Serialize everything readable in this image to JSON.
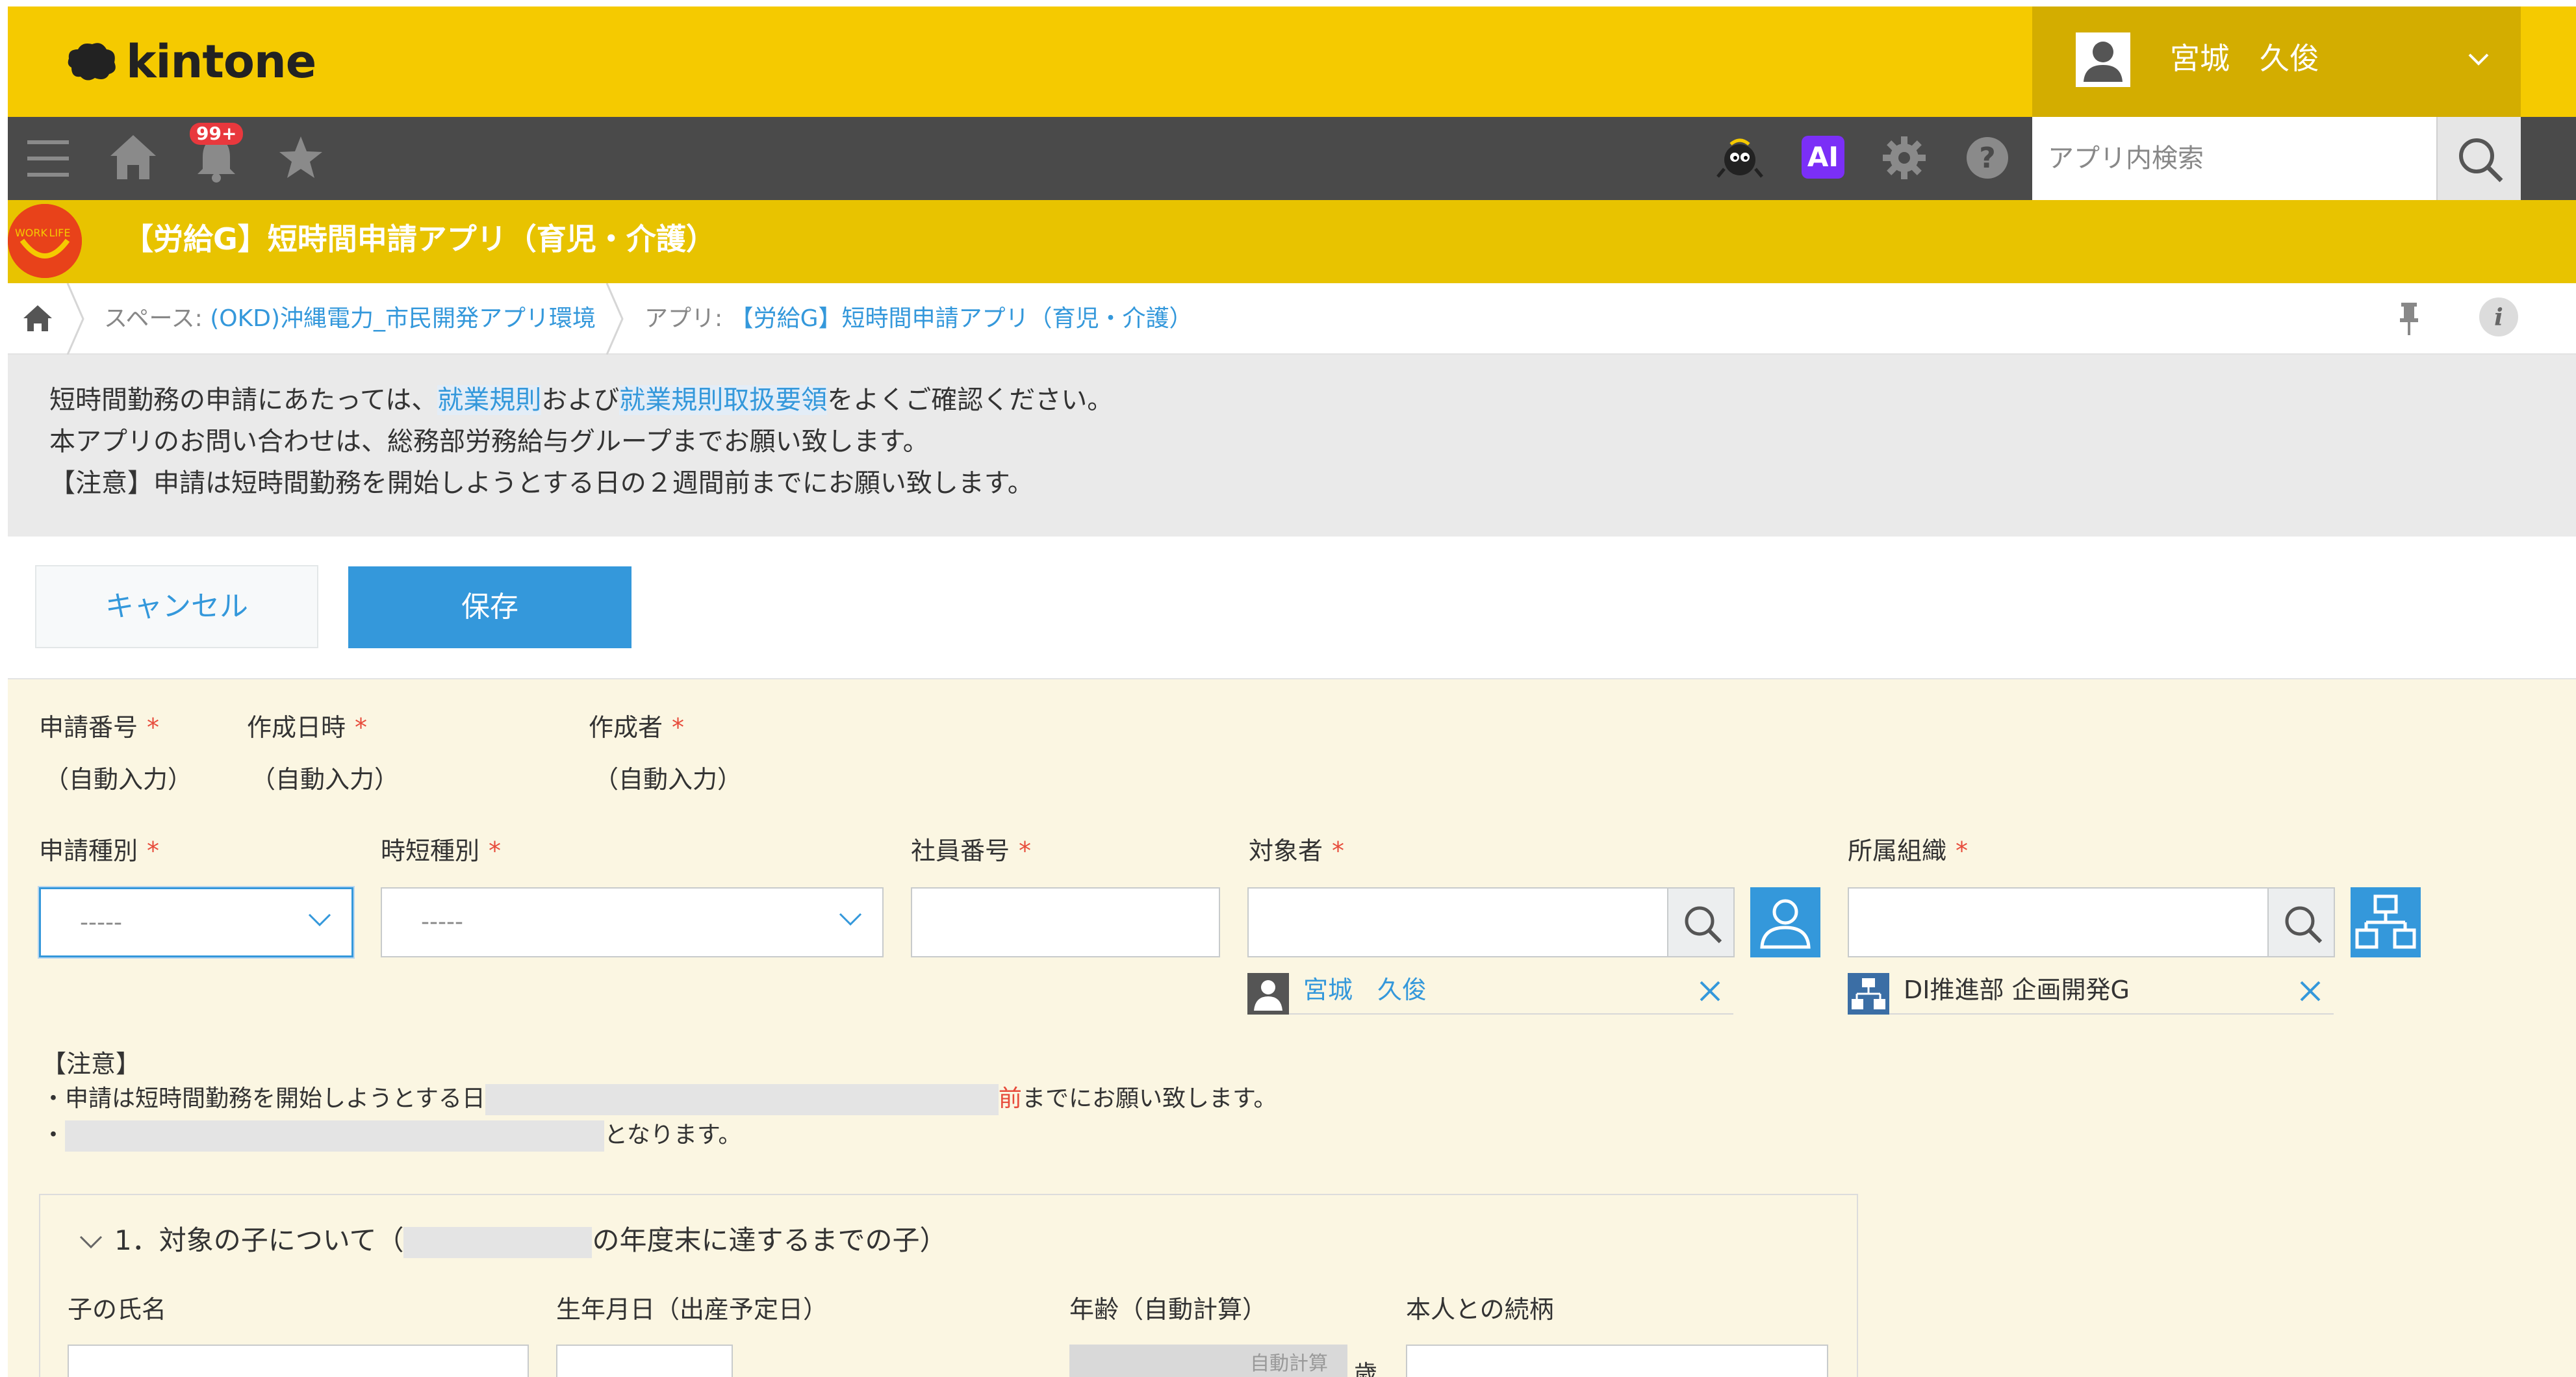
{
  "header": {
    "logo_text": "kintone",
    "user_name": "宮城　久俊",
    "notification_count": "99+",
    "ai_label": "AI",
    "search_placeholder": "アプリ内検索"
  },
  "app": {
    "title": "【労給G】短時間申請アプリ（育児・介護）",
    "icon_text": "WORK LIFE"
  },
  "breadcrumb": {
    "space_prefix": "スペース: ",
    "space_name": "(OKD)沖縄電力_市民開発アプリ環境",
    "app_prefix": "アプリ: ",
    "app_name": "【労給G】短時間申請アプリ（育児・介護）"
  },
  "notice": {
    "line1_a": "短時間勤務の申請にあたっては、",
    "line1_link1": "就業規則",
    "line1_b": "および",
    "line1_link2": "就業規則取扱要領",
    "line1_c": "をよくご確認ください。",
    "line2": "本アプリのお問い合わせは、総務部労務給与グループまでお願い致します。",
    "line3": "【注意】申請は短時間勤務を開始しようとする日の２週間前までにお願い致します。"
  },
  "actions": {
    "cancel_label": "キャンセル",
    "save_label": "保存"
  },
  "form": {
    "row1": {
      "app_no_label": "申請番号",
      "app_no_value": "（自動入力）",
      "created_at_label": "作成日時",
      "created_at_value": "（自動入力）",
      "creator_label": "作成者",
      "creator_value": "（自動入力）"
    },
    "row2": {
      "app_type_label": "申請種別",
      "app_type_value": "-----",
      "short_type_label": "時短種別",
      "short_type_value": "-----",
      "emp_no_label": "社員番号",
      "target_label": "対象者",
      "target_selected": "宮城　久俊",
      "org_label": "所属組織",
      "org_selected": "DI推進部 企画開発G"
    },
    "caution": {
      "title": "【注意】",
      "line1_a": "・申請は短時間勤務を開始しようとする日",
      "line1_mark": "前",
      "line1_b": "までにお願い致します。",
      "line2_a": "・",
      "line2_b": "となります。"
    },
    "section1": {
      "title_a": "1．対象の子について（",
      "title_b": "の年度末に達するまでの子）",
      "child_name_label": "子の氏名",
      "birth_label": "生年月日（出産予定日）",
      "age_label": "年齢（自動計算）",
      "age_placeholder": "自動計算",
      "age_unit": "歳",
      "relation_label": "本人との続柄"
    }
  },
  "colors": {
    "header_yellow": "#f5ca00",
    "user_box": "#d3ad00",
    "nav_dark": "#4a4a4a",
    "app_bar": "#e8c300",
    "accent_blue": "#3498db",
    "required_red": "#e74c3c",
    "form_bg": "#fbf6e2"
  },
  "icons": {
    "menu": "hamburger-icon",
    "home": "home-icon",
    "bell": "bell-icon",
    "favorite": "star-icon",
    "mascot": "mascot-icon",
    "settings": "gear-icon",
    "help": "help-icon",
    "search": "search-icon",
    "pin": "pin-icon",
    "info": "info-icon"
  }
}
